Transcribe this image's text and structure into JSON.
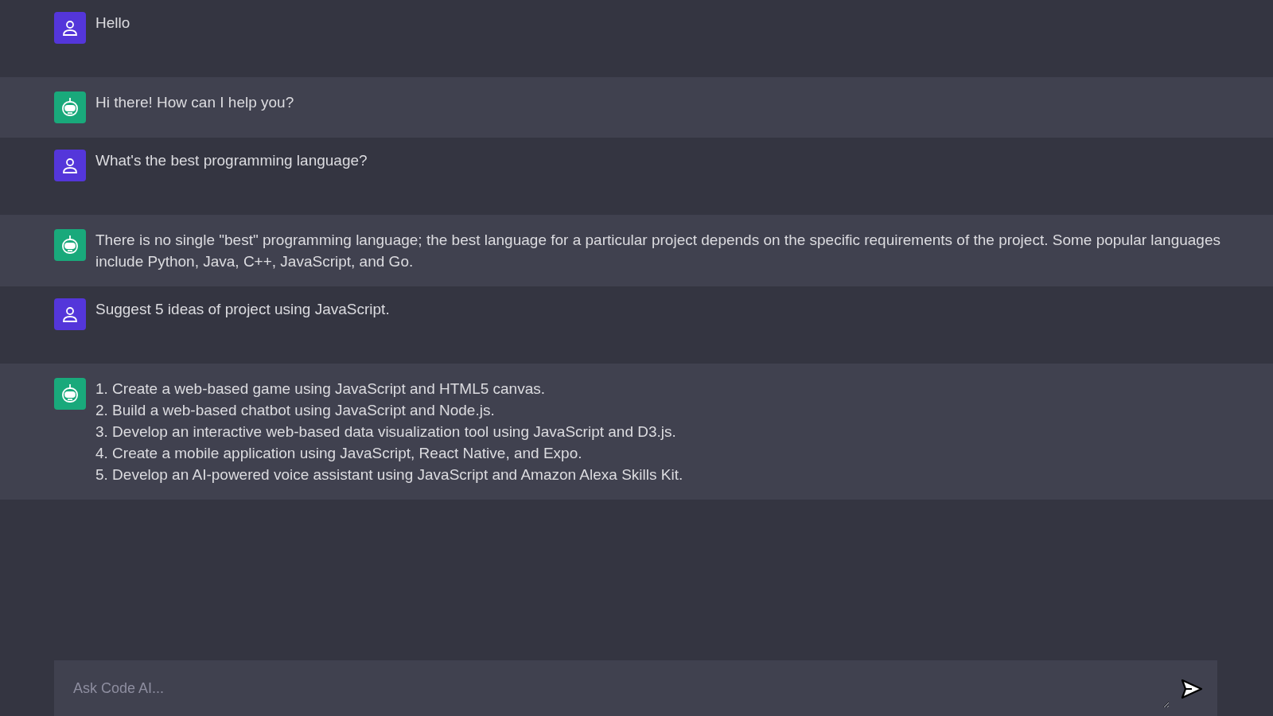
{
  "messages": [
    {
      "kind": "user",
      "lines": [
        "Hello"
      ]
    },
    {
      "kind": "bot",
      "lines": [
        "Hi there! How can I help you?"
      ]
    },
    {
      "kind": "user",
      "lines": [
        "What's the best programming language?"
      ]
    },
    {
      "kind": "bot",
      "lines": [
        "There is no single \"best\" programming language; the best language for a particular project depends on the specific requirements of the project. Some popular languages include Python, Java, C++, JavaScript, and Go."
      ]
    },
    {
      "kind": "user",
      "lines": [
        "Suggest 5 ideas of project using JavaScript."
      ]
    },
    {
      "kind": "bot",
      "lines": [
        "1. Create a web-based game using JavaScript and HTML5 canvas.",
        "2. Build a web-based chatbot using JavaScript and Node.js.",
        "3. Develop an interactive web-based data visualization tool using JavaScript and D3.js.",
        "4. Create a mobile application using JavaScript, React Native, and Expo.",
        "5. Develop an AI-powered voice assistant using JavaScript and Amazon Alexa Skills Kit."
      ]
    }
  ],
  "composer": {
    "placeholder": "Ask Code AI..."
  }
}
